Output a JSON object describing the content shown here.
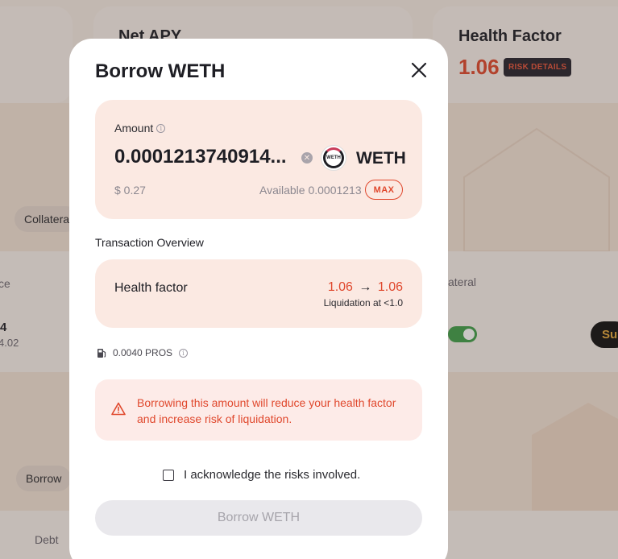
{
  "background": {
    "net_apy_title": "Net APY",
    "health_factor_title": "Health Factor",
    "health_factor_value": "1.06",
    "risk_details_label": "RISK DETAILS",
    "collateral_chip": "Collatera",
    "balance_col": "ce",
    "collateral_col": "ateral",
    "row_value": "4",
    "row_sub": "4.02",
    "supply_btn": "Su",
    "borrow_chip": "Borrow",
    "debt_col": "Debt"
  },
  "modal": {
    "title": "Borrow WETH",
    "amount": {
      "label": "Amount",
      "value": "0.0001213740914...",
      "token_symbol": "WETH",
      "token_icon_text": "WETH",
      "usd_value": "$ 0.27",
      "available_label": "Available",
      "available_value": "0.0001213",
      "max_label": "MAX"
    },
    "overview": {
      "label": "Transaction Overview",
      "health_factor_label": "Health factor",
      "hf_from": "1.06",
      "hf_to": "1.06",
      "arrow": "→",
      "liquidation_text": "Liquidation at <1.0"
    },
    "gas": {
      "value": "0.0040 PROS"
    },
    "warning": {
      "text": "Borrowing this amount will reduce your health factor and increase risk of liquidation."
    },
    "acknowledge_label": "I acknowledge the risks involved.",
    "submit_label": "Borrow WETH"
  },
  "colors": {
    "accent": "#e0482d",
    "panel": "#fbe9e2",
    "warning_bg": "#fdebe8",
    "button_disabled": "#e9e8ec"
  }
}
